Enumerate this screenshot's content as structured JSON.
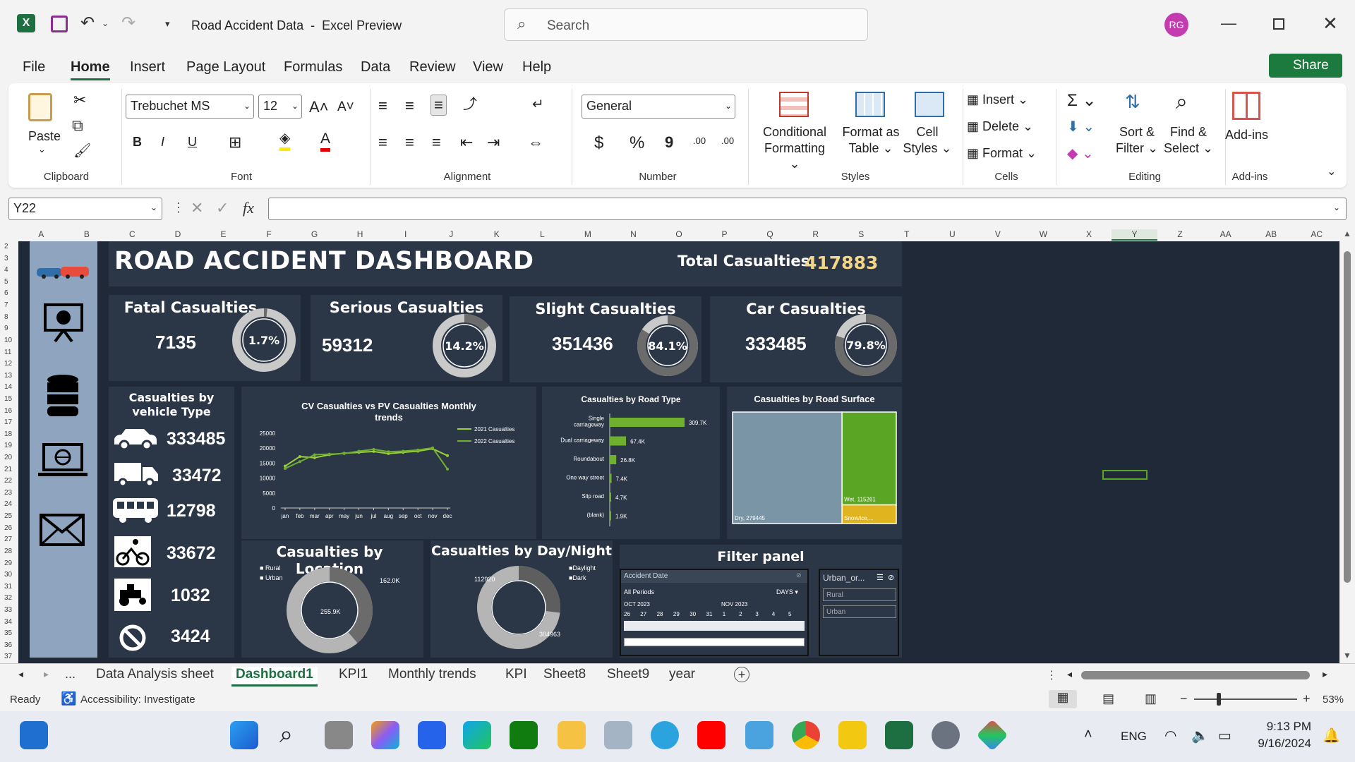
{
  "window": {
    "title": "Road Accident Data  -  Excel Preview",
    "search_placeholder": "Search",
    "avatar": "RG"
  },
  "menu": [
    "File",
    "Home",
    "Insert",
    "Page Layout",
    "Formulas",
    "Data",
    "Review",
    "View",
    "Help"
  ],
  "share_label": "Share",
  "ribbon": {
    "clipboard": {
      "paste": "Paste",
      "label": "Clipboard"
    },
    "font": {
      "name": "Trebuchet MS",
      "size": "12",
      "label": "Font",
      "bold": "B",
      "italic": "I",
      "underline": "U"
    },
    "alignment": {
      "label": "Alignment"
    },
    "number": {
      "format": "General",
      "label": "Number",
      "currency": "$",
      "percent": "%",
      "comma": "9",
      "inc": ".00",
      "dec": ".00"
    },
    "styles": {
      "conditional": "Conditional",
      "conditional2": "Formatting",
      "format_as": "Format as",
      "format_as2": "Table",
      "cell": "Cell",
      "cell2": "Styles",
      "label": "Styles"
    },
    "cells": {
      "insert": "Insert",
      "delete": "Delete",
      "format": "Format",
      "label": "Cells"
    },
    "editing": {
      "sort": "Sort &",
      "sort2": "Filter",
      "find": "Find &",
      "find2": "Select",
      "label": "Editing"
    },
    "addins": {
      "name": "Add-ins",
      "label": "Add-ins"
    }
  },
  "formula": {
    "name_box": "Y22",
    "fx": "fx",
    "content": ""
  },
  "columns": [
    "A",
    "B",
    "C",
    "D",
    "E",
    "F",
    "G",
    "H",
    "I",
    "J",
    "K",
    "L",
    "M",
    "N",
    "O",
    "P",
    "Q",
    "R",
    "S",
    "T",
    "U",
    "V",
    "W",
    "X",
    "Y",
    "Z",
    "AA",
    "AB",
    "AC"
  ],
  "rows": [
    "2",
    "3",
    "4",
    "5",
    "6",
    "7",
    "8",
    "9",
    "10",
    "11",
    "12",
    "13",
    "14",
    "15",
    "16",
    "17",
    "18",
    "19",
    "20",
    "21",
    "22",
    "23",
    "24",
    "25",
    "26",
    "27",
    "28",
    "29",
    "30",
    "31",
    "32",
    "33",
    "34",
    "35",
    "36",
    "37"
  ],
  "dashboard": {
    "title": "ROAD ACCIDENT DASHBOARD",
    "total_label": "Total Casualties",
    "total_value": "417883",
    "kpis": [
      {
        "title": "Fatal Casualties",
        "value": "7135",
        "pct": "1.7%",
        "fraction": 0.017
      },
      {
        "title": "Serious Casualties",
        "value": "59312",
        "pct": "14.2%",
        "fraction": 0.142
      },
      {
        "title": "Slight Casualties",
        "value": "351436",
        "pct": "84.1%",
        "fraction": 0.841
      },
      {
        "title": "Car Casualties",
        "value": "333485",
        "pct": "79.8%",
        "fraction": 0.798
      }
    ],
    "vehicle": {
      "title1": "Casualties by",
      "title2": "vehicle Type",
      "items": [
        {
          "icon": "car-icon",
          "value": "333485"
        },
        {
          "icon": "truck-icon",
          "value": "33472"
        },
        {
          "icon": "bus-icon",
          "value": "12798"
        },
        {
          "icon": "bicycle-icon",
          "value": "33672"
        },
        {
          "icon": "tractor-icon",
          "value": "1032"
        },
        {
          "icon": "no-entry-icon",
          "value": "3424"
        }
      ]
    },
    "location": {
      "title": "Casualties by Location",
      "legend": [
        "Rural",
        "Urban"
      ],
      "label_rural": "162.0K",
      "label_urban": "255.9K"
    },
    "daynight": {
      "title": "Casualties by Day/Night",
      "legend": [
        "Daylight",
        "Dark"
      ],
      "label_a": "112920",
      "label_b": "304963"
    },
    "filter": {
      "title": "Filter panel",
      "timeline_title": "Accident Date",
      "periods": "All Periods",
      "unit": "DAYS",
      "month1": "OCT 2023",
      "month2": "NOV 2023",
      "days": [
        "26",
        "27",
        "28",
        "29",
        "30",
        "31",
        "1",
        "2",
        "3",
        "4",
        "5"
      ],
      "slicer_title": "Urban_or...",
      "slicer_items": [
        "Rural",
        "Urban"
      ]
    }
  },
  "chart_data": [
    {
      "type": "line",
      "title": "CV Casualties vs PV Casualties Monthly trends",
      "categories": [
        "jan",
        "feb",
        "mar",
        "apr",
        "may",
        "jun",
        "jul",
        "aug",
        "sep",
        "oct",
        "nov",
        "dec"
      ],
      "ylim": [
        0,
        25000
      ],
      "yticks": [
        "25000",
        "20000",
        "15000",
        "10000",
        "5000",
        "0"
      ],
      "series": [
        {
          "name": "2021 Casualties",
          "values": [
            14000,
            17200,
            16800,
            17800,
            18300,
            18600,
            18900,
            18200,
            18600,
            19000,
            19800,
            17500
          ]
        },
        {
          "name": "2022 Casualties",
          "values": [
            13200,
            15500,
            17800,
            18000,
            18200,
            19000,
            19600,
            18800,
            19000,
            19400,
            20100,
            13000
          ]
        }
      ]
    },
    {
      "type": "bar",
      "title": "Casualties by Road Type",
      "categories": [
        "Single carriageway",
        "Dual carriageway",
        "Roundabout",
        "One way street",
        "Slip road",
        "(blank)"
      ],
      "values": [
        309700,
        67400,
        26800,
        7400,
        4700,
        1900
      ],
      "labels": [
        "309.7K",
        "67.4K",
        "26.8K",
        "7.4K",
        "4.7K",
        "1.9K"
      ]
    },
    {
      "type": "heatmap",
      "title": "Casualties by Road Surface",
      "categories": [
        "Dry",
        "Wet",
        "Snow/ice,..."
      ],
      "values": [
        279445,
        115261,
        23177
      ],
      "labels": [
        "Dry, 279445",
        "Wet, 115261",
        "Snow/ice,..."
      ],
      "colors": [
        "#7a95a6",
        "#5aa624",
        "#e0b41e"
      ]
    }
  ],
  "sheets": [
    "Data Analysis sheet",
    "Dashboard1",
    "KPI1",
    "Monthly trends",
    "KPI",
    "Sheet8",
    "Sheet9",
    "year"
  ],
  "status": {
    "ready": "Ready",
    "accessibility": "Accessibility: Investigate",
    "zoom": "53%"
  },
  "taskbar": {
    "lang": "ENG",
    "time": "9:13 PM",
    "date": "9/16/2024"
  }
}
